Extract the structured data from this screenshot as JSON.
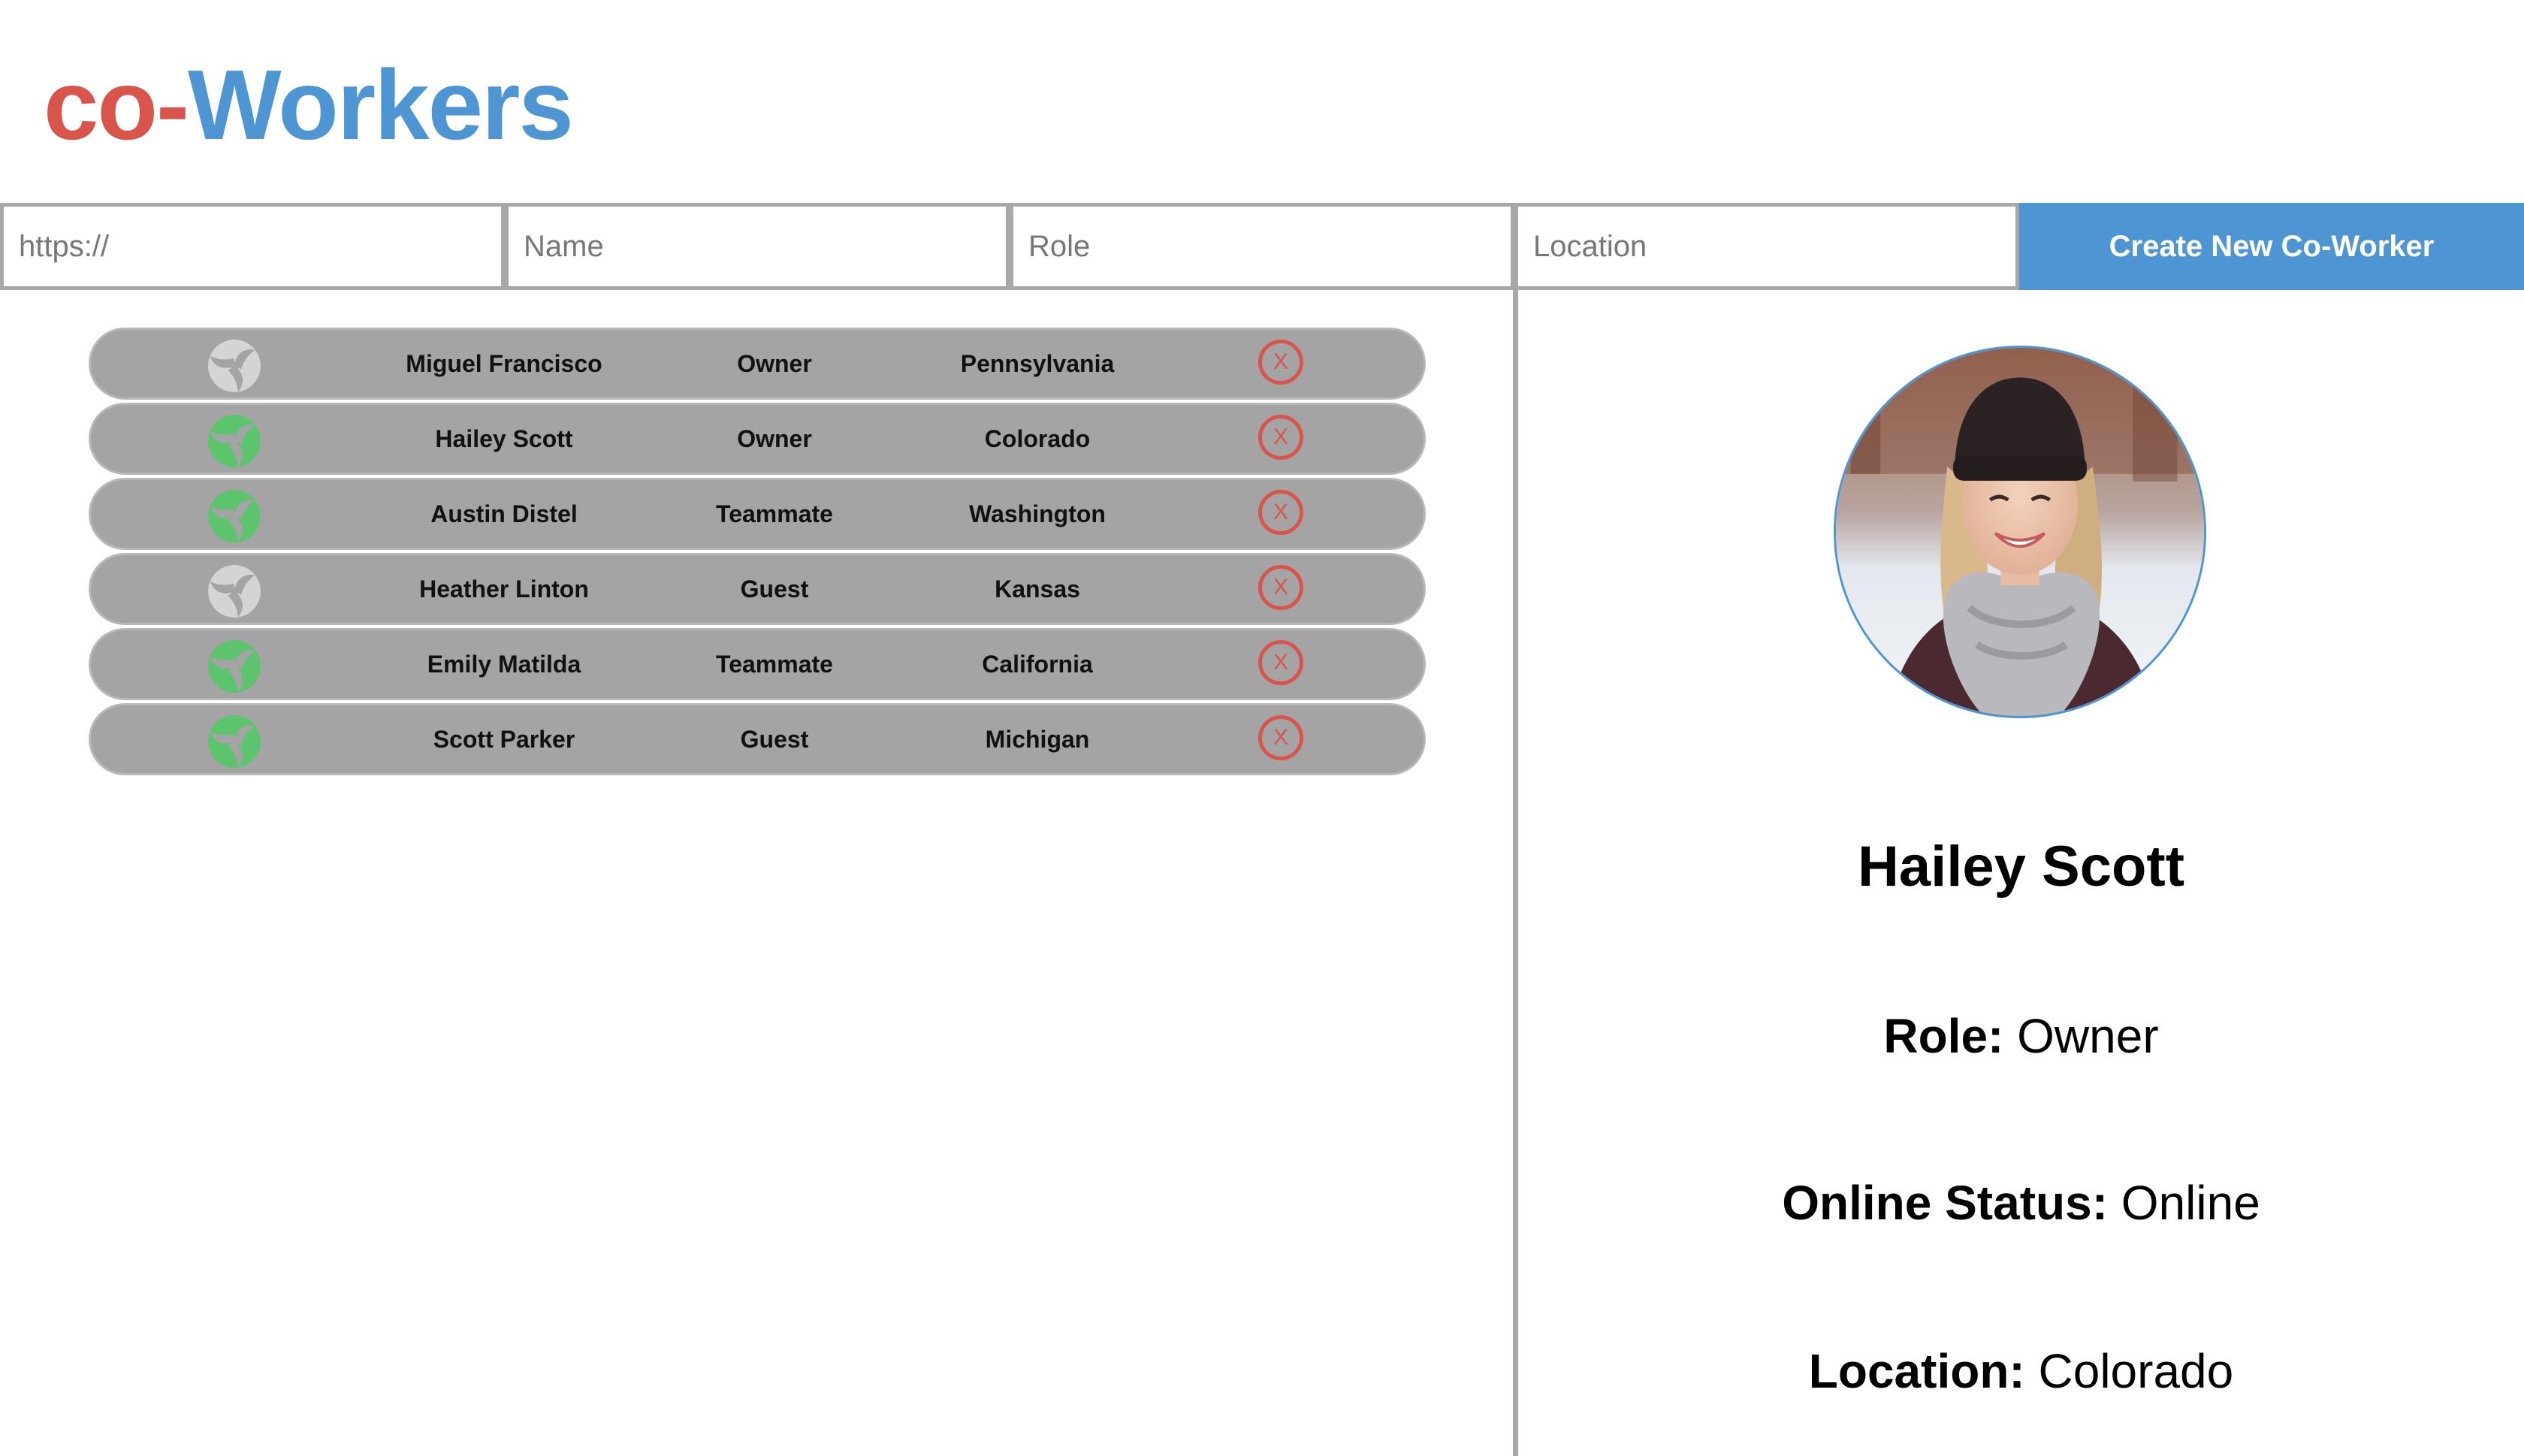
{
  "app": {
    "logo_part1": "co-",
    "logo_part2": "Workers",
    "brand_red": "#d9544a",
    "brand_blue": "#4e95d4"
  },
  "form": {
    "url_placeholder": "https://",
    "name_placeholder": "Name",
    "role_placeholder": "Role",
    "location_placeholder": "Location",
    "create_label": "Create New Co-Worker"
  },
  "coworkers": [
    {
      "name": "Miguel Francisco",
      "role": "Owner",
      "location": "Pennsylvania",
      "online": false,
      "delete_label": "X",
      "status_icon": "status-icon-offline"
    },
    {
      "name": "Hailey Scott",
      "role": "Owner",
      "location": "Colorado",
      "online": true,
      "delete_label": "X",
      "status_icon": "status-icon-online"
    },
    {
      "name": "Austin Distel",
      "role": "Teammate",
      "location": "Washington",
      "online": true,
      "delete_label": "X",
      "status_icon": "status-icon-online"
    },
    {
      "name": "Heather Linton",
      "role": "Guest",
      "location": "Kansas",
      "online": false,
      "delete_label": "X",
      "status_icon": "status-icon-offline"
    },
    {
      "name": "Emily Matilda",
      "role": "Teammate",
      "location": "California",
      "online": true,
      "delete_label": "X",
      "status_icon": "status-icon-online"
    },
    {
      "name": "Scott Parker",
      "role": "Guest",
      "location": "Michigan",
      "online": true,
      "delete_label": "X",
      "status_icon": "status-icon-online"
    }
  ],
  "status_colors": {
    "online": "#5cc46c",
    "offline": "#d4d4d4"
  },
  "selected": {
    "name": "Hailey Scott",
    "role_label": "Role:",
    "role": "Owner",
    "status_label": "Online Status:",
    "status": "Online",
    "location_label": "Location:",
    "location": "Colorado"
  }
}
